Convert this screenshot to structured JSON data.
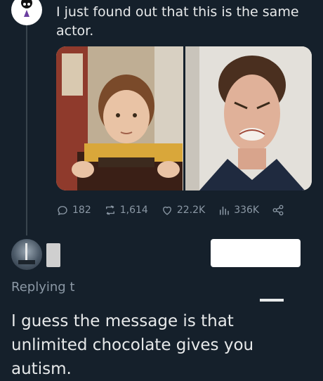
{
  "tweet": {
    "text": "I just found out that this is the same actor.",
    "media": {
      "left_description": "Child actor holding golden ticket",
      "right_description": "Adult actor making a face"
    },
    "stats": {
      "replies": "182",
      "retweets": "1,614",
      "likes": "22.2K",
      "views": "336K"
    }
  },
  "reply": {
    "replying_label": "Replying t",
    "text": "I guess the message is that unlimited chocolate gives you autism."
  },
  "colors": {
    "background": "#15202b",
    "text": "#e7e9ea",
    "muted": "#8b98a5"
  }
}
